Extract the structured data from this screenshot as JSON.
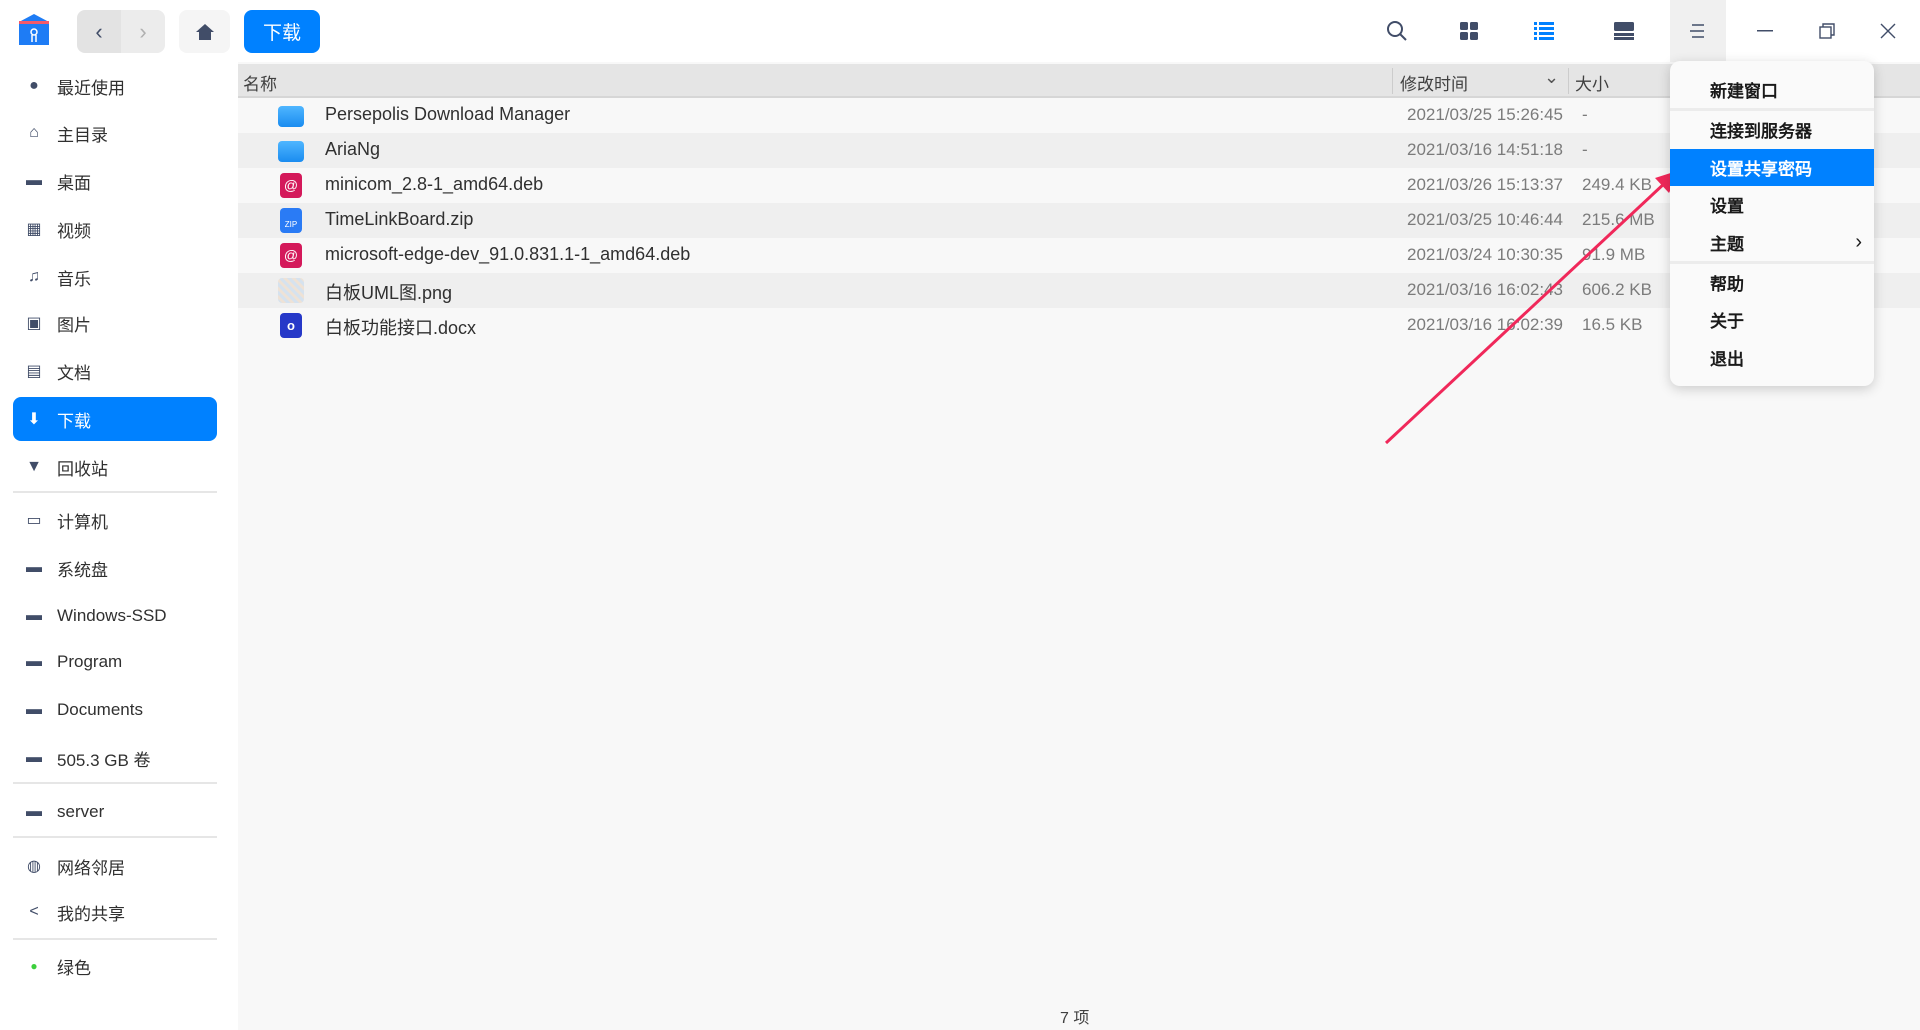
{
  "toolbar": {
    "location_button": "下载",
    "accent": "#0081ff"
  },
  "sidebar": {
    "items": [
      {
        "label": "最近使用",
        "icon": "clock-icon"
      },
      {
        "label": "主目录",
        "icon": "home-icon"
      },
      {
        "label": "桌面",
        "icon": "desktop-icon"
      },
      {
        "label": "视频",
        "icon": "video-icon"
      },
      {
        "label": "音乐",
        "icon": "music-icon"
      },
      {
        "label": "图片",
        "icon": "picture-icon"
      },
      {
        "label": "文档",
        "icon": "document-icon"
      },
      {
        "label": "下载",
        "icon": "download-icon",
        "selected": true
      },
      {
        "label": "回收站",
        "icon": "trash-icon"
      },
      {
        "label": "计算机",
        "icon": "computer-icon"
      },
      {
        "label": "系统盘",
        "icon": "disk-icon"
      },
      {
        "label": "Windows-SSD",
        "icon": "disk-icon"
      },
      {
        "label": "Program",
        "icon": "disk-icon"
      },
      {
        "label": "Documents",
        "icon": "disk-icon"
      },
      {
        "label": "505.3 GB 卷",
        "icon": "disk-icon"
      },
      {
        "label": "server",
        "icon": "server-icon"
      },
      {
        "label": "网络邻居",
        "icon": "network-icon"
      },
      {
        "label": "我的共享",
        "icon": "share-icon"
      },
      {
        "label": "绿色",
        "icon": "green-tag-icon"
      }
    ]
  },
  "columns": {
    "name": "名称",
    "modified": "修改时间",
    "size": "大小"
  },
  "files": [
    {
      "name": "Persepolis Download Manager",
      "modified": "2021/03/25 15:26:45",
      "size": "-",
      "type": "folder"
    },
    {
      "name": "AriaNg",
      "modified": "2021/03/16 14:51:18",
      "size": "-",
      "type": "folder"
    },
    {
      "name": "minicom_2.8-1_amd64.deb",
      "modified": "2021/03/26 15:13:37",
      "size": "249.4 KB",
      "type": "deb"
    },
    {
      "name": "TimeLinkBoard.zip",
      "modified": "2021/03/25 10:46:44",
      "size": "215.6 MB",
      "type": "zip"
    },
    {
      "name": "microsoft-edge-dev_91.0.831.1-1_amd64.deb",
      "modified": "2021/03/24 10:30:35",
      "size": "91.9 MB",
      "type": "deb"
    },
    {
      "name": "白板UML图.png",
      "modified": "2021/03/16 16:02:43",
      "size": "606.2 KB",
      "type": "png"
    },
    {
      "name": "白板功能接口.docx",
      "modified": "2021/03/16 16:02:39",
      "size": "16.5 KB",
      "type": "docx"
    }
  ],
  "menu": {
    "items": [
      "新建窗口",
      "连接到服务器",
      "设置共享密码",
      "设置",
      "主题",
      "帮助",
      "关于",
      "退出"
    ]
  },
  "status": {
    "count": "7 项"
  }
}
